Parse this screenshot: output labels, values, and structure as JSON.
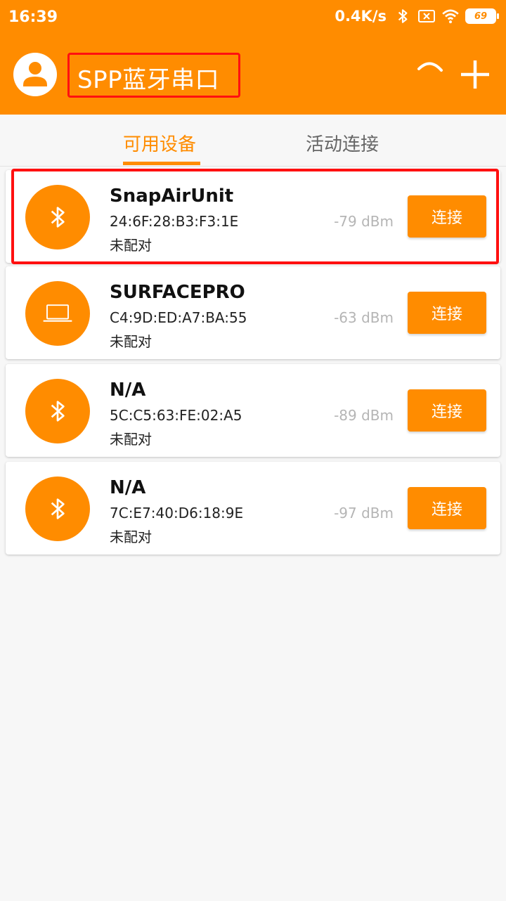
{
  "status_bar": {
    "time": "16:39",
    "net_speed": "0.4K/s",
    "battery": "69",
    "icons": [
      "bluetooth-icon",
      "sim-none-icon",
      "wifi-icon",
      "battery-icon"
    ]
  },
  "app_bar": {
    "title": "SPP蓝牙串口",
    "icons": [
      "avatar-icon",
      "refresh-icon",
      "add-icon"
    ]
  },
  "tabs": [
    {
      "label": "可用设备",
      "active": true
    },
    {
      "label": "活动连接",
      "active": false
    }
  ],
  "devices": [
    {
      "name": "SnapAirUnit",
      "mac": "24:6F:28:B3:F3:1E",
      "status": "未配对",
      "rssi": "-79 dBm",
      "icon": "bluetooth-icon",
      "button": "连接"
    },
    {
      "name": "SURFACEPRO",
      "mac": "C4:9D:ED:A7:BA:55",
      "status": "未配对",
      "rssi": "-63 dBm",
      "icon": "laptop-icon",
      "button": "连接"
    },
    {
      "name": "N/A",
      "mac": "5C:C5:63:FE:02:A5",
      "status": "未配对",
      "rssi": "-89 dBm",
      "icon": "bluetooth-icon",
      "button": "连接"
    },
    {
      "name": "N/A",
      "mac": "7C:E7:40:D6:18:9E",
      "status": "未配对",
      "rssi": "-97 dBm",
      "icon": "bluetooth-icon",
      "button": "连接"
    }
  ],
  "colors": {
    "accent": "#ff8c00",
    "highlight": "#ff1010"
  }
}
